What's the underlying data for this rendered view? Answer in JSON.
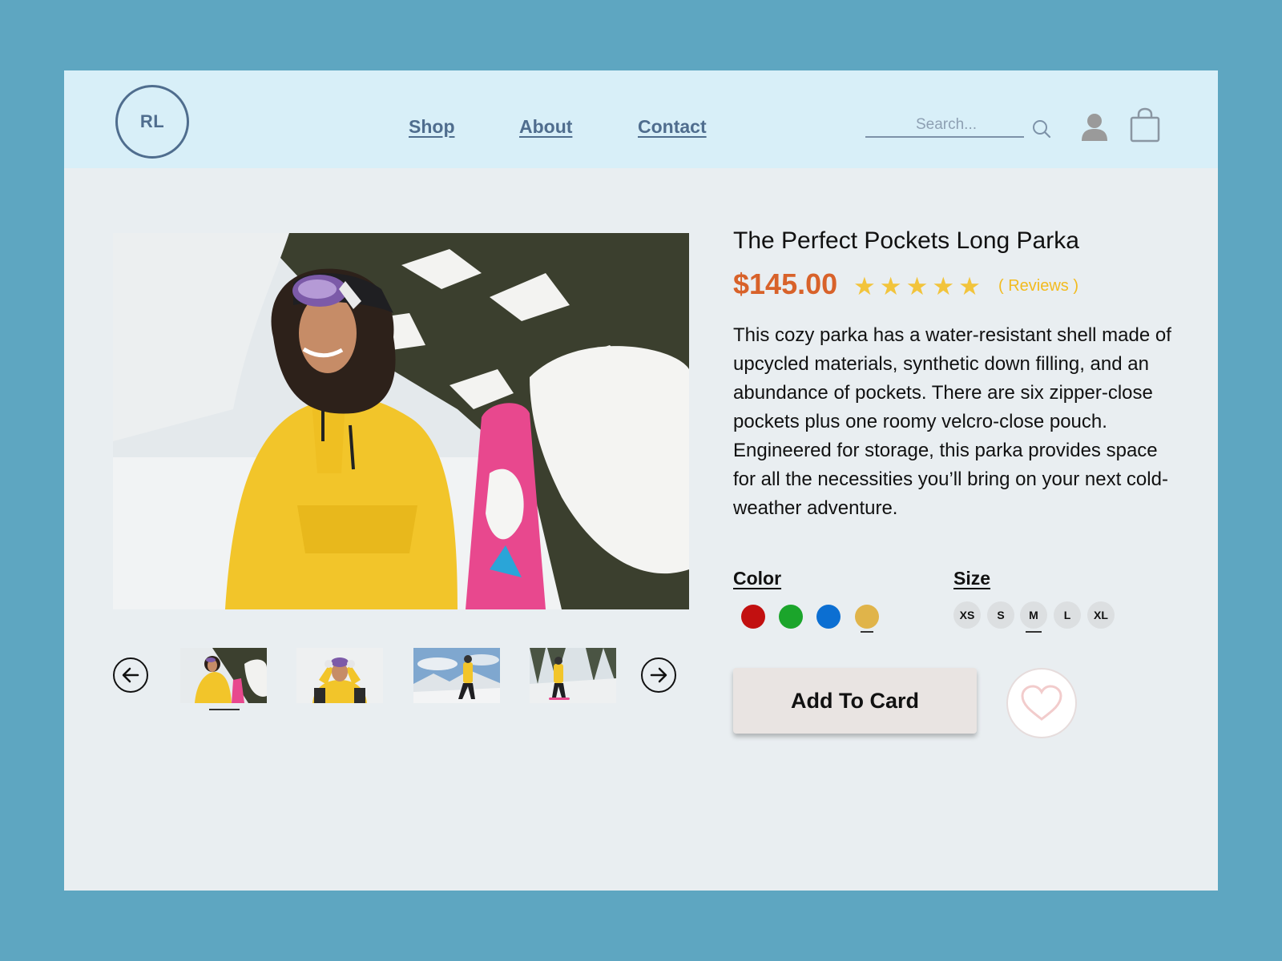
{
  "header": {
    "logo_text": "RL",
    "nav": [
      "Shop",
      "About",
      "Contact"
    ],
    "search_placeholder": "Search..."
  },
  "product": {
    "title": "The Perfect Pockets Long Parka",
    "price": "$145.00",
    "stars": "★★★★★",
    "rating": 5,
    "reviews_label": "( Reviews )",
    "description": "This cozy parka has a water-resistant shell made of upcycled materials, synthetic down filling, and an abundance of pockets. There are six zipper-close pockets plus one roomy velcro-close pouch. Engineered for storage, this parka provides space for all the necessities you’ll bring on your next cold-weather adventure."
  },
  "options": {
    "color_label": "Color",
    "size_label": "Size",
    "colors": [
      {
        "name": "red",
        "hex": "#c21010"
      },
      {
        "name": "green",
        "hex": "#1ba52b"
      },
      {
        "name": "blue",
        "hex": "#0c6fd2"
      },
      {
        "name": "yellow",
        "hex": "#e0b44a",
        "selected": true
      }
    ],
    "sizes": [
      "XS",
      "S",
      "M",
      "L",
      "XL"
    ],
    "selected_size": "M"
  },
  "actions": {
    "add_label": "Add To Card"
  },
  "icons": [
    "search-icon",
    "user-icon",
    "shopping-bag-icon",
    "arrow-left-icon",
    "arrow-right-icon",
    "heart-icon"
  ]
}
